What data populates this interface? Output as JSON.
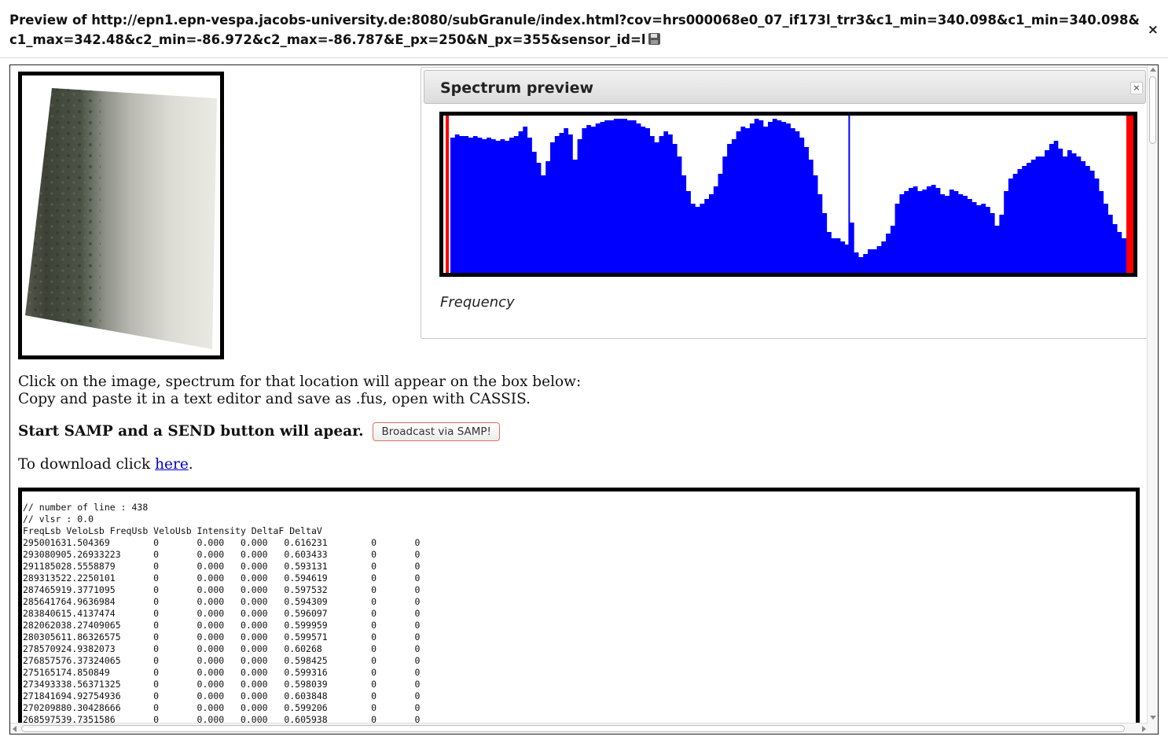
{
  "window": {
    "title": "Preview of http://epn1.epn-vespa.jacobs-university.de:8080/subGranule/index.html?cov=hrs000068e0_07_if173l_trr3&c1_min=340.098&c1_min=340.098&c1_max=342.48&c2_min=-86.972&c2_max=-86.787&E_px=250&N_px=355&sensor_id=l",
    "save_icon": "floppy-disk-icon",
    "close_label": "×"
  },
  "spectrum_panel": {
    "title": "Spectrum preview",
    "close_label": "×",
    "xlabel": "Frequency"
  },
  "chart_data": {
    "type": "area",
    "title": "Spectrum preview",
    "xlabel": "Frequency",
    "ylabel": "",
    "fill_color": "#0000ff",
    "marker_color": "#ff0000",
    "peak_line_color": "#0000ff",
    "peak_line_at": 0.59,
    "ylim": [
      0,
      1
    ],
    "grid": false,
    "legend": "none",
    "values": [
      0.86,
      0.88,
      0.87,
      0.87,
      0.86,
      0.87,
      0.86,
      0.85,
      0.86,
      0.85,
      0.84,
      0.85,
      0.84,
      0.86,
      0.87,
      0.9,
      0.93,
      0.86,
      0.77,
      0.7,
      0.62,
      0.71,
      0.83,
      0.87,
      0.89,
      0.92,
      0.88,
      0.72,
      0.85,
      0.92,
      0.94,
      0.93,
      0.95,
      0.96,
      0.97,
      0.97,
      0.98,
      0.98,
      0.98,
      0.97,
      0.97,
      0.95,
      0.93,
      0.92,
      0.87,
      0.83,
      0.87,
      0.9,
      0.88,
      0.82,
      0.74,
      0.62,
      0.52,
      0.44,
      0.42,
      0.44,
      0.47,
      0.5,
      0.55,
      0.63,
      0.74,
      0.82,
      0.85,
      0.9,
      0.93,
      0.92,
      0.95,
      0.98,
      0.97,
      0.93,
      0.96,
      0.98,
      0.97,
      0.96,
      0.95,
      0.92,
      0.9,
      0.86,
      0.8,
      0.72,
      0.62,
      0.5,
      0.38,
      0.26,
      0.22,
      0.22,
      0.2,
      0.18,
      0.32,
      0.13,
      0.1,
      0.12,
      0.15,
      0.15,
      0.17,
      0.2,
      0.25,
      0.3,
      0.44,
      0.5,
      0.52,
      0.54,
      0.55,
      0.52,
      0.53,
      0.55,
      0.56,
      0.54,
      0.5,
      0.49,
      0.53,
      0.52,
      0.5,
      0.49,
      0.47,
      0.45,
      0.43,
      0.44,
      0.42,
      0.38,
      0.3,
      0.37,
      0.52,
      0.6,
      0.63,
      0.66,
      0.68,
      0.7,
      0.72,
      0.74,
      0.74,
      0.78,
      0.82,
      0.84,
      0.79,
      0.74,
      0.78,
      0.76,
      0.74,
      0.71,
      0.68,
      0.65,
      0.6,
      0.52,
      0.44,
      0.37,
      0.31,
      0.26,
      0.22
    ]
  },
  "instructions": {
    "line1": "Click on the image, spectrum for that location will appear on the box below:",
    "line2": "Copy and paste it in a text editor and save as .fus, open with CASSIS."
  },
  "samp": {
    "text": "Start SAMP and a SEND button will apear.",
    "button_label": "Broadcast via SAMP!"
  },
  "download": {
    "prefix": "To download click ",
    "link_text": "here",
    "suffix": "."
  },
  "data_output": {
    "header_lines": [
      "// number of line : 438",
      "// vlsr : 0.0",
      "FreqLsb VeloLsb FreqUsb VeloUsb Intensity DeltaF DeltaV"
    ],
    "rows": [
      [
        "295001631.504369",
        "0",
        "0.000",
        "0.000",
        "0.616231",
        "0",
        "0"
      ],
      [
        "293080905.26933223",
        "0",
        "0.000",
        "0.000",
        "0.603433",
        "0",
        "0"
      ],
      [
        "291185028.5558879",
        "0",
        "0.000",
        "0.000",
        "0.593131",
        "0",
        "0"
      ],
      [
        "289313522.2250101",
        "0",
        "0.000",
        "0.000",
        "0.594619",
        "0",
        "0"
      ],
      [
        "287465919.3771095",
        "0",
        "0.000",
        "0.000",
        "0.597532",
        "0",
        "0"
      ],
      [
        "285641764.9636984",
        "0",
        "0.000",
        "0.000",
        "0.594309",
        "0",
        "0"
      ],
      [
        "283840615.4137474",
        "0",
        "0.000",
        "0.000",
        "0.596097",
        "0",
        "0"
      ],
      [
        "282062038.27409065",
        "0",
        "0.000",
        "0.000",
        "0.599959",
        "0",
        "0"
      ],
      [
        "280305611.86326575",
        "0",
        "0.000",
        "0.000",
        "0.599571",
        "0",
        "0"
      ],
      [
        "278570924.9382073",
        "0",
        "0.000",
        "0.000",
        "0.60268",
        "0",
        "0"
      ],
      [
        "276857576.37324065",
        "0",
        "0.000",
        "0.000",
        "0.598425",
        "0",
        "0"
      ],
      [
        "275165174.850849",
        "0",
        "0.000",
        "0.000",
        "0.599316",
        "0",
        "0"
      ],
      [
        "273493338.56371325",
        "0",
        "0.000",
        "0.000",
        "0.598039",
        "0",
        "0"
      ],
      [
        "271841694.92754936",
        "0",
        "0.000",
        "0.000",
        "0.603848",
        "0",
        "0"
      ],
      [
        "270209880.30428666",
        "0",
        "0.000",
        "0.000",
        "0.599206",
        "0",
        "0"
      ],
      [
        "268597539.7351586",
        "0",
        "0.000",
        "0.000",
        "0.605938",
        "0",
        "0"
      ]
    ]
  }
}
